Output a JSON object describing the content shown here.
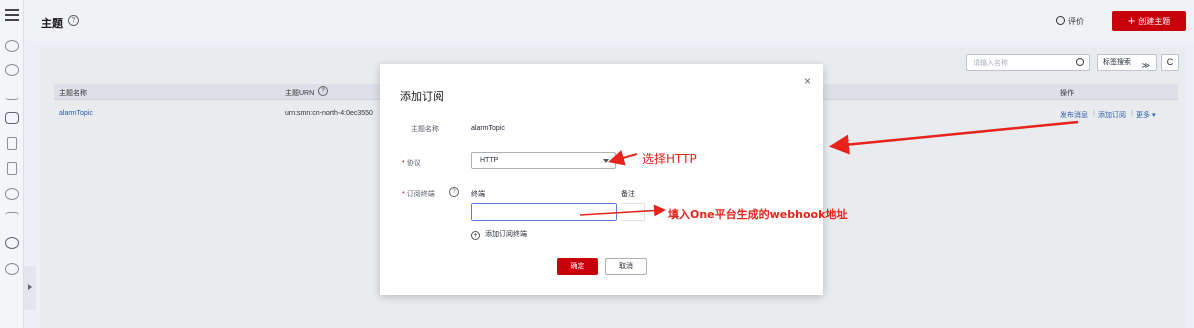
{
  "header": {
    "title": "主题",
    "help": "?",
    "rate_label": "评价",
    "create_button": "创建主题",
    "create_plus": "+"
  },
  "toolbar": {
    "search_placeholder": "请输入名称",
    "tag_search_label": "标签搜索",
    "tag_search_chevron": "≫",
    "refresh_glyph": "C"
  },
  "table": {
    "columns": [
      "主题名称",
      "主题URN",
      "操作"
    ],
    "urn_help": "?",
    "rows": [
      {
        "name": "alarmTopic",
        "urn": "urn:smn:cn-north-4:0ec3550",
        "actions": [
          "发布消息",
          "添加订阅",
          "更多 ▾"
        ],
        "sep": "|"
      }
    ]
  },
  "modal": {
    "title": "添加订阅",
    "close": "×",
    "topic_name_label": "主题名称",
    "topic_name_value": "alarmTopic",
    "required_mark": "*",
    "protocol_label": "协议",
    "protocol_value": "HTTP",
    "endpoint_label": "订阅终端",
    "endpoint_help": "?",
    "endpoint_col": "终端",
    "remark_col": "备注",
    "endpoint_value": "",
    "add_endpoint_label": "添加订阅终端",
    "add_endpoint_glyph": "+",
    "confirm_label": "确定",
    "cancel_label": "取消"
  },
  "annotations": {
    "select_http": "选择HTTP",
    "fill_webhook": "填入One平台生成的webhook地址",
    "color": "#e8231b"
  },
  "colors": {
    "brand_red": "#c7000b",
    "link_blue": "#2a5ea8"
  }
}
